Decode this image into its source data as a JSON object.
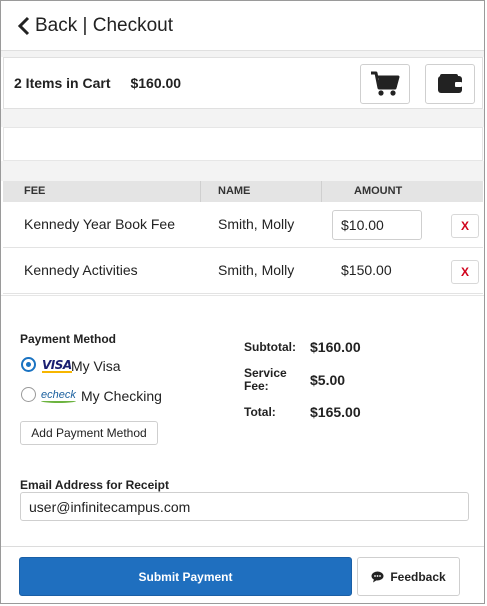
{
  "header": {
    "title": "Back | Checkout",
    "back_icon": "chevron-left-icon"
  },
  "cart": {
    "items_label": "2 Items in Cart",
    "total": "$160.00",
    "cart_icon": "shopping-cart-icon",
    "wallet_icon": "wallet-icon"
  },
  "table": {
    "headers": [
      "FEE",
      "NAME",
      "AMOUNT"
    ],
    "rows": [
      {
        "fee": "Kennedy Year Book Fee",
        "name": "Smith, Molly",
        "amount": "$10.00",
        "editable": true,
        "remove": "X"
      },
      {
        "fee": "Kennedy Activities",
        "name": "Smith, Molly",
        "amount": "$150.00",
        "editable": false,
        "remove": "X"
      }
    ]
  },
  "payment": {
    "title": "Payment Method",
    "methods": [
      {
        "brand": "VISA",
        "label": "My Visa",
        "selected": true
      },
      {
        "brand": "echeck",
        "label": "My Checking",
        "selected": false
      }
    ],
    "add_label": "Add Payment Method"
  },
  "summary": {
    "subtotal_label": "Subtotal:",
    "subtotal": "$160.00",
    "fee_label_1": "Service",
    "fee_label_2": "Fee:",
    "fee": "$5.00",
    "total_label": "Total:",
    "total": "$165.00"
  },
  "email": {
    "label": "Email Address for Receipt",
    "value": "user@infinitecampus.com"
  },
  "footer": {
    "submit_label": "Submit Payment",
    "feedback_label": "Feedback",
    "feedback_icon": "speech-bubble-icon"
  },
  "colors": {
    "primary": "#1f6fbf",
    "remove": "#d0021b"
  }
}
